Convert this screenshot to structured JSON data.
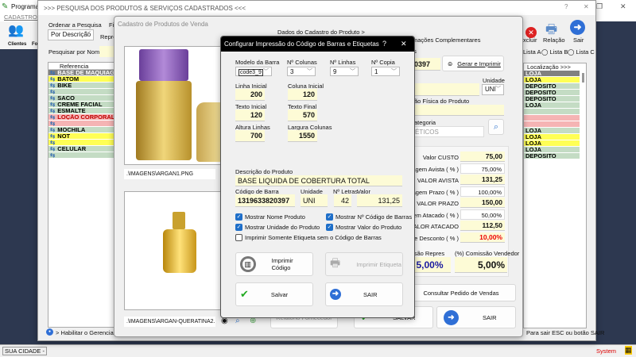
{
  "main_window": {
    "title": "Programa F",
    "menu": "CADASTROS",
    "toolbar": [
      "Clientes",
      "Fo"
    ],
    "status_left": "SUA CIDADE -",
    "status_right": "System"
  },
  "search_window": {
    "title": ">>> PESQUISA DOS PRODUTOS & SERVIÇOS CADASTRADOS <<<",
    "order_label": "Ordenar a Pesquisa",
    "order_value": "Por Descrição",
    "filter_label": "Fil",
    "repr_label": "Repre",
    "search_label": "Pesquisar por Nome",
    "search_value": "",
    "toolbar": {
      "delete": "Excluir",
      "report": "Relação",
      "exit": "Sair"
    },
    "lists": [
      "Lista A",
      "Lista B",
      "Lista C"
    ],
    "grid_header": "Referencia",
    "grid_header2": "C",
    "grid_rows": [
      {
        "ref": "BASE DE MAQUIAGE",
        "loc": "LOJA",
        "color": "#808080",
        "text": "#ffffff"
      },
      {
        "ref": "BATOM",
        "loc": "LOJA",
        "color": "#ffff55",
        "text": "#000"
      },
      {
        "ref": "BIKE",
        "loc": "DEPOSITO",
        "color": "#c4dcc4",
        "text": "#000"
      },
      {
        "ref": "",
        "loc": "DEPOSITO",
        "color": "#c4dcc4",
        "text": "#000"
      },
      {
        "ref": "SACO",
        "loc": "DEPOSITO",
        "color": "#c4dcc4",
        "text": "#000"
      },
      {
        "ref": "CREME FACIAL",
        "loc": "LOJA",
        "color": "#c4dcc4",
        "text": "#000"
      },
      {
        "ref": "ESMALTE",
        "loc": "",
        "color": "#c4dcc4",
        "text": "#000"
      },
      {
        "ref": "LOÇÃO CORPORAL",
        "loc": "",
        "color": "#f5b4b4",
        "text": "#c00000"
      },
      {
        "ref": "",
        "loc": "",
        "color": "#f5b4b4",
        "text": "#000"
      },
      {
        "ref": "MOCHILA",
        "loc": "LOJA",
        "color": "#c4dcc4",
        "text": "#000"
      },
      {
        "ref": "NOT",
        "loc": "LOJA",
        "color": "#ffff55",
        "text": "#000"
      },
      {
        "ref": "",
        "loc": "LOJA",
        "color": "#ffff55",
        "text": "#000"
      },
      {
        "ref": "CELULAR",
        "loc": "LOJA",
        "color": "#c4dcc4",
        "text": "#000"
      },
      {
        "ref": "",
        "loc": "DEPOSITO",
        "color": "#c4dcc4",
        "text": "#000"
      }
    ],
    "loc_header": "Localização >>>",
    "habilitar": "> Habilitar o Gerenciament",
    "exit_hint": "Para sair ESC ou botão SAIR"
  },
  "product_window": {
    "title": "Cadastro de Produtos de Venda",
    "tabs": [
      "Dados do Cadastro do Produto >",
      "Informações Complementares"
    ],
    "image1_path": ".\\IMAGENS\\ARGAN1.PNG",
    "image2_path": ".\\IMAGENS\\ARGAN-QUERATINA2.PN",
    "barcode_label": "as",
    "barcode_value": "0397",
    "gerar_button": "Gerar e Imprimir",
    "unidade_label": "Unidade",
    "unidade_value": "UNI",
    "fisica_label": "ão Física do Produto",
    "categoria_label": "ategoria",
    "categoria_value": "ÉTICOS",
    "prices": [
      {
        "label": "Valor CUSTO",
        "value": "75,00",
        "kind": "val"
      },
      {
        "label": "agem Avista ( % )",
        "value": "75,00%",
        "kind": "pct"
      },
      {
        "label": "VALOR AVISTA",
        "value": "131,25",
        "kind": "val"
      },
      {
        "label": "agem Prazo ( % )",
        "value": "100,00%",
        "kind": "pct"
      },
      {
        "label": "VALOR PRAZO",
        "value": "150,00",
        "kind": "val"
      },
      {
        "label": "em Atacado ( % )",
        "value": "50,00%",
        "kind": "pct"
      },
      {
        "label": "ALOR ATACADO",
        "value": "112,50",
        "kind": "val"
      },
      {
        "label": "e Desconto ( % )",
        "value": "10,00%",
        "kind": "red"
      }
    ],
    "com_repres_label": "ssão Repres",
    "com_repres": "5,00%",
    "com_vend_label": "(%) Comissão Vendedor",
    "com_vend": "5,00%",
    "consultar_button": "Consultar Pedido de Vendas",
    "relatorio_button": "Relatório Fornecedor",
    "salvar_button": "SALVAR",
    "sair_button": "SAIR"
  },
  "dialog": {
    "title": "Configurar Impressão do Código de Barras e Etiquetas",
    "help": "?",
    "close": "✕",
    "modelo_label": "Modelo da Barra",
    "modelo": "code3_9",
    "colunas_label": "Nº Colunas",
    "colunas": "3",
    "linhas_label": "Nº Linhas",
    "linhas": "9",
    "copia_label": "Nº Copia",
    "copia": "1",
    "linha_inicial_label": "Linha Inicial",
    "linha_inicial": "200",
    "coluna_inicial_label": "Coluna Inicial",
    "coluna_inicial": "120",
    "texto_inicial_label": "Texto Inicial",
    "texto_inicial": "120",
    "texto_final_label": "Texto Final",
    "texto_final": "570",
    "altura_label": "Altura Linhas",
    "altura": "700",
    "largura_label": "Largura Colunas",
    "largura": "1550",
    "descricao_label": "Descrição do Produto",
    "descricao": "BASE LIQUIDA DE COBERTURA TOTAL",
    "codigo_label": "Código de Barra",
    "codigo": "1319633820397",
    "unidade_label": "Unidade",
    "unidade": "UNI",
    "letras_label": "Nº Letras",
    "letras": "42",
    "valor_label": "Valor",
    "valor": "131,25",
    "checks": [
      {
        "label": "Mostrar Nome Produto",
        "checked": true
      },
      {
        "label": "Mostrar Nº Código de Barras",
        "checked": true
      },
      {
        "label": "Mostrar Unidade do Produto",
        "checked": true
      },
      {
        "label": "Mostrar Valor do Produto",
        "checked": true
      },
      {
        "label": "Imprimir Somente Etiqueta sem o Código de Barras",
        "checked": false
      }
    ],
    "imprimir_codigo": "Imprimir Código",
    "imprimir_etiqueta": "Imprimir Etiqueta",
    "salvar": "Salvar",
    "sair": "SAIR"
  }
}
